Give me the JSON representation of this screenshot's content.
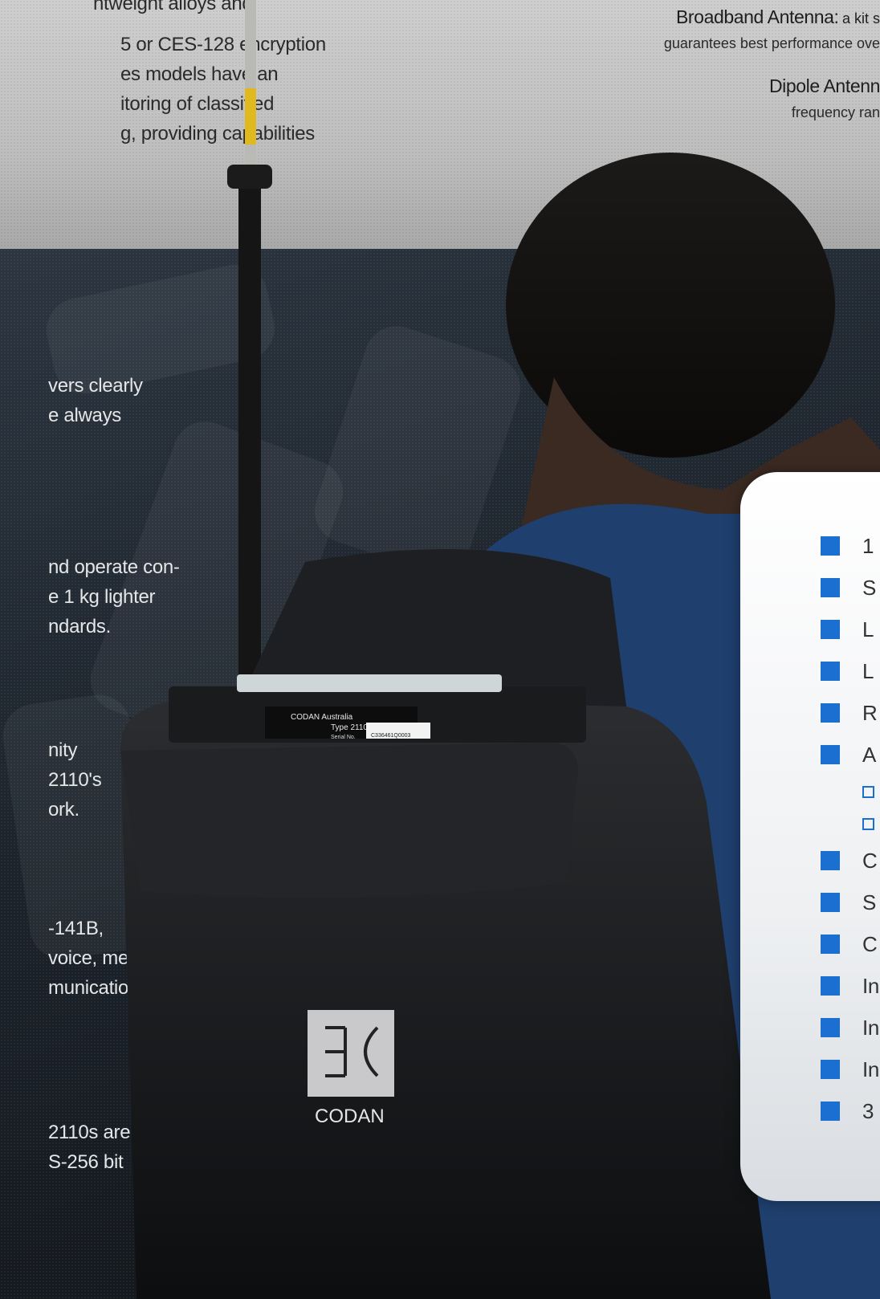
{
  "left_column": {
    "top_lines": [
      "htweight alloys and",
      "",
      "5 or CES-128 encryption",
      "es models have an",
      "itoring of classified",
      "g, providing capabilities"
    ],
    "block1": [
      "vers clearly",
      "e always"
    ],
    "block2": [
      "nd operate con-",
      "e 1 kg lighter",
      "ndards."
    ],
    "block3": [
      "nity",
      "2110's",
      "ork."
    ],
    "block4": [
      "-141B,",
      "voice, message,",
      "munication."
    ],
    "block5": [
      "2110s are",
      "S-256 bit"
    ]
  },
  "right_notes": {
    "broadband_title": "Broadband Antenna:",
    "broadband_text": "a kit s",
    "broadband_line2": "guarantees best performance ove",
    "dipole_title": "Dipole Antenn",
    "dipole_text": "frequency ran"
  },
  "radio": {
    "brand": "CODAN",
    "label_line1": "CODAN Australia",
    "label_line2": "Type 2110",
    "serial_label": "Serial No.",
    "serial_value": "C336461Q0003"
  },
  "features_card": {
    "items": [
      {
        "text": "1",
        "type": "main"
      },
      {
        "text": "S",
        "type": "main"
      },
      {
        "text": "L",
        "type": "main"
      },
      {
        "text": "L",
        "type": "main"
      },
      {
        "text": "R",
        "type": "main"
      },
      {
        "text": "A",
        "type": "main"
      },
      {
        "text": "",
        "type": "sub"
      },
      {
        "text": "",
        "type": "sub"
      },
      {
        "text": "C",
        "type": "main"
      },
      {
        "text": "S",
        "type": "main"
      },
      {
        "text": "C",
        "type": "main"
      },
      {
        "text": "In",
        "type": "main"
      },
      {
        "text": "In",
        "type": "main"
      },
      {
        "text": "In",
        "type": "main"
      },
      {
        "text": "3",
        "type": "main"
      }
    ]
  },
  "colors": {
    "accent": "#1a6fd0",
    "top_band": "#c4c4c4",
    "dark_band": "#1c232b"
  }
}
